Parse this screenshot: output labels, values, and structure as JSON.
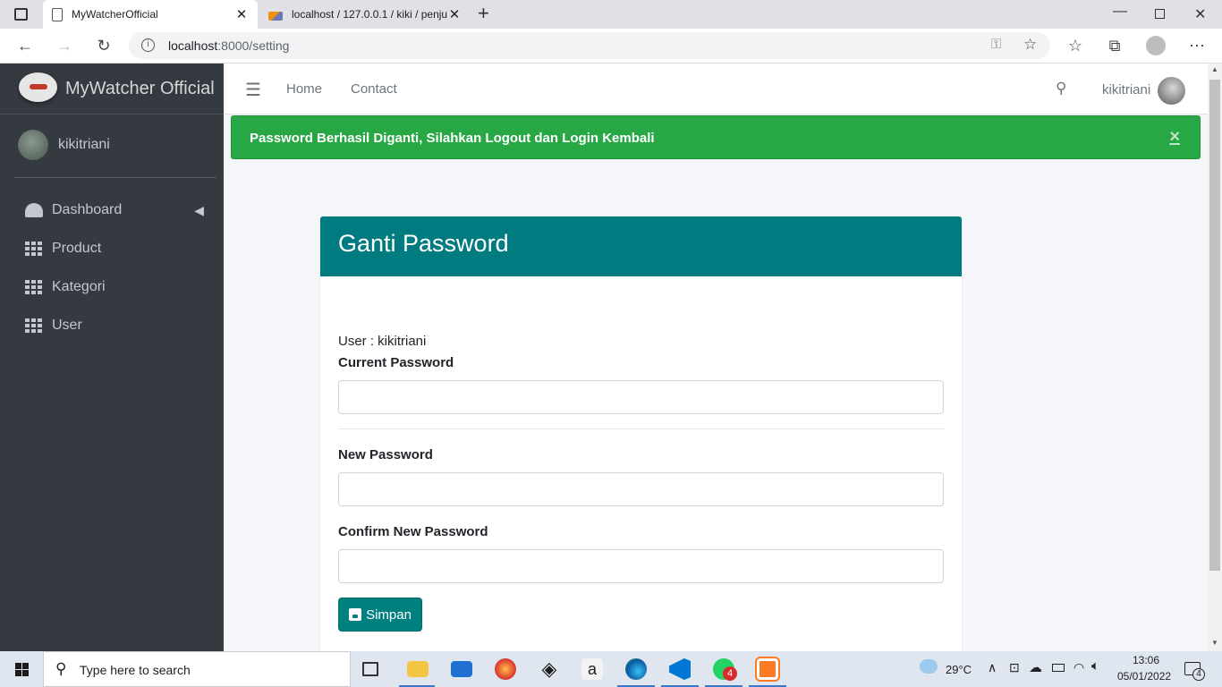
{
  "browser": {
    "tabs": [
      {
        "title": "MyWatcherOfficial"
      },
      {
        "title": "localhost / 127.0.0.1 / kiki / penju"
      }
    ],
    "url_host": "localhost",
    "url_path": ":8000/setting"
  },
  "sidebar": {
    "brand": "MyWatcher Official",
    "user": "kikitriani",
    "items": [
      {
        "label": "Dashboard"
      },
      {
        "label": "Product"
      },
      {
        "label": "Kategori"
      },
      {
        "label": "User"
      }
    ]
  },
  "topnav": {
    "links": [
      {
        "label": "Home"
      },
      {
        "label": "Contact"
      }
    ],
    "user": "kikitriani"
  },
  "alert": {
    "message": "Password Berhasil Diganti, Silahkan Logout dan Login Kembali",
    "close": "×",
    "color": "#28a745"
  },
  "card": {
    "title": "Ganti Password",
    "user_line": "User : kikitriani",
    "current_label": "Current Password",
    "new_label": "New Password",
    "confirm_label": "Confirm New Password",
    "save_label": "Simpan",
    "header_color": "#007b80"
  },
  "taskbar": {
    "search_placeholder": "Type here to search",
    "temperature": "29°C",
    "time": "13:06",
    "date": "05/01/2022",
    "notifications": "4",
    "whatsapp_badge": "4"
  }
}
